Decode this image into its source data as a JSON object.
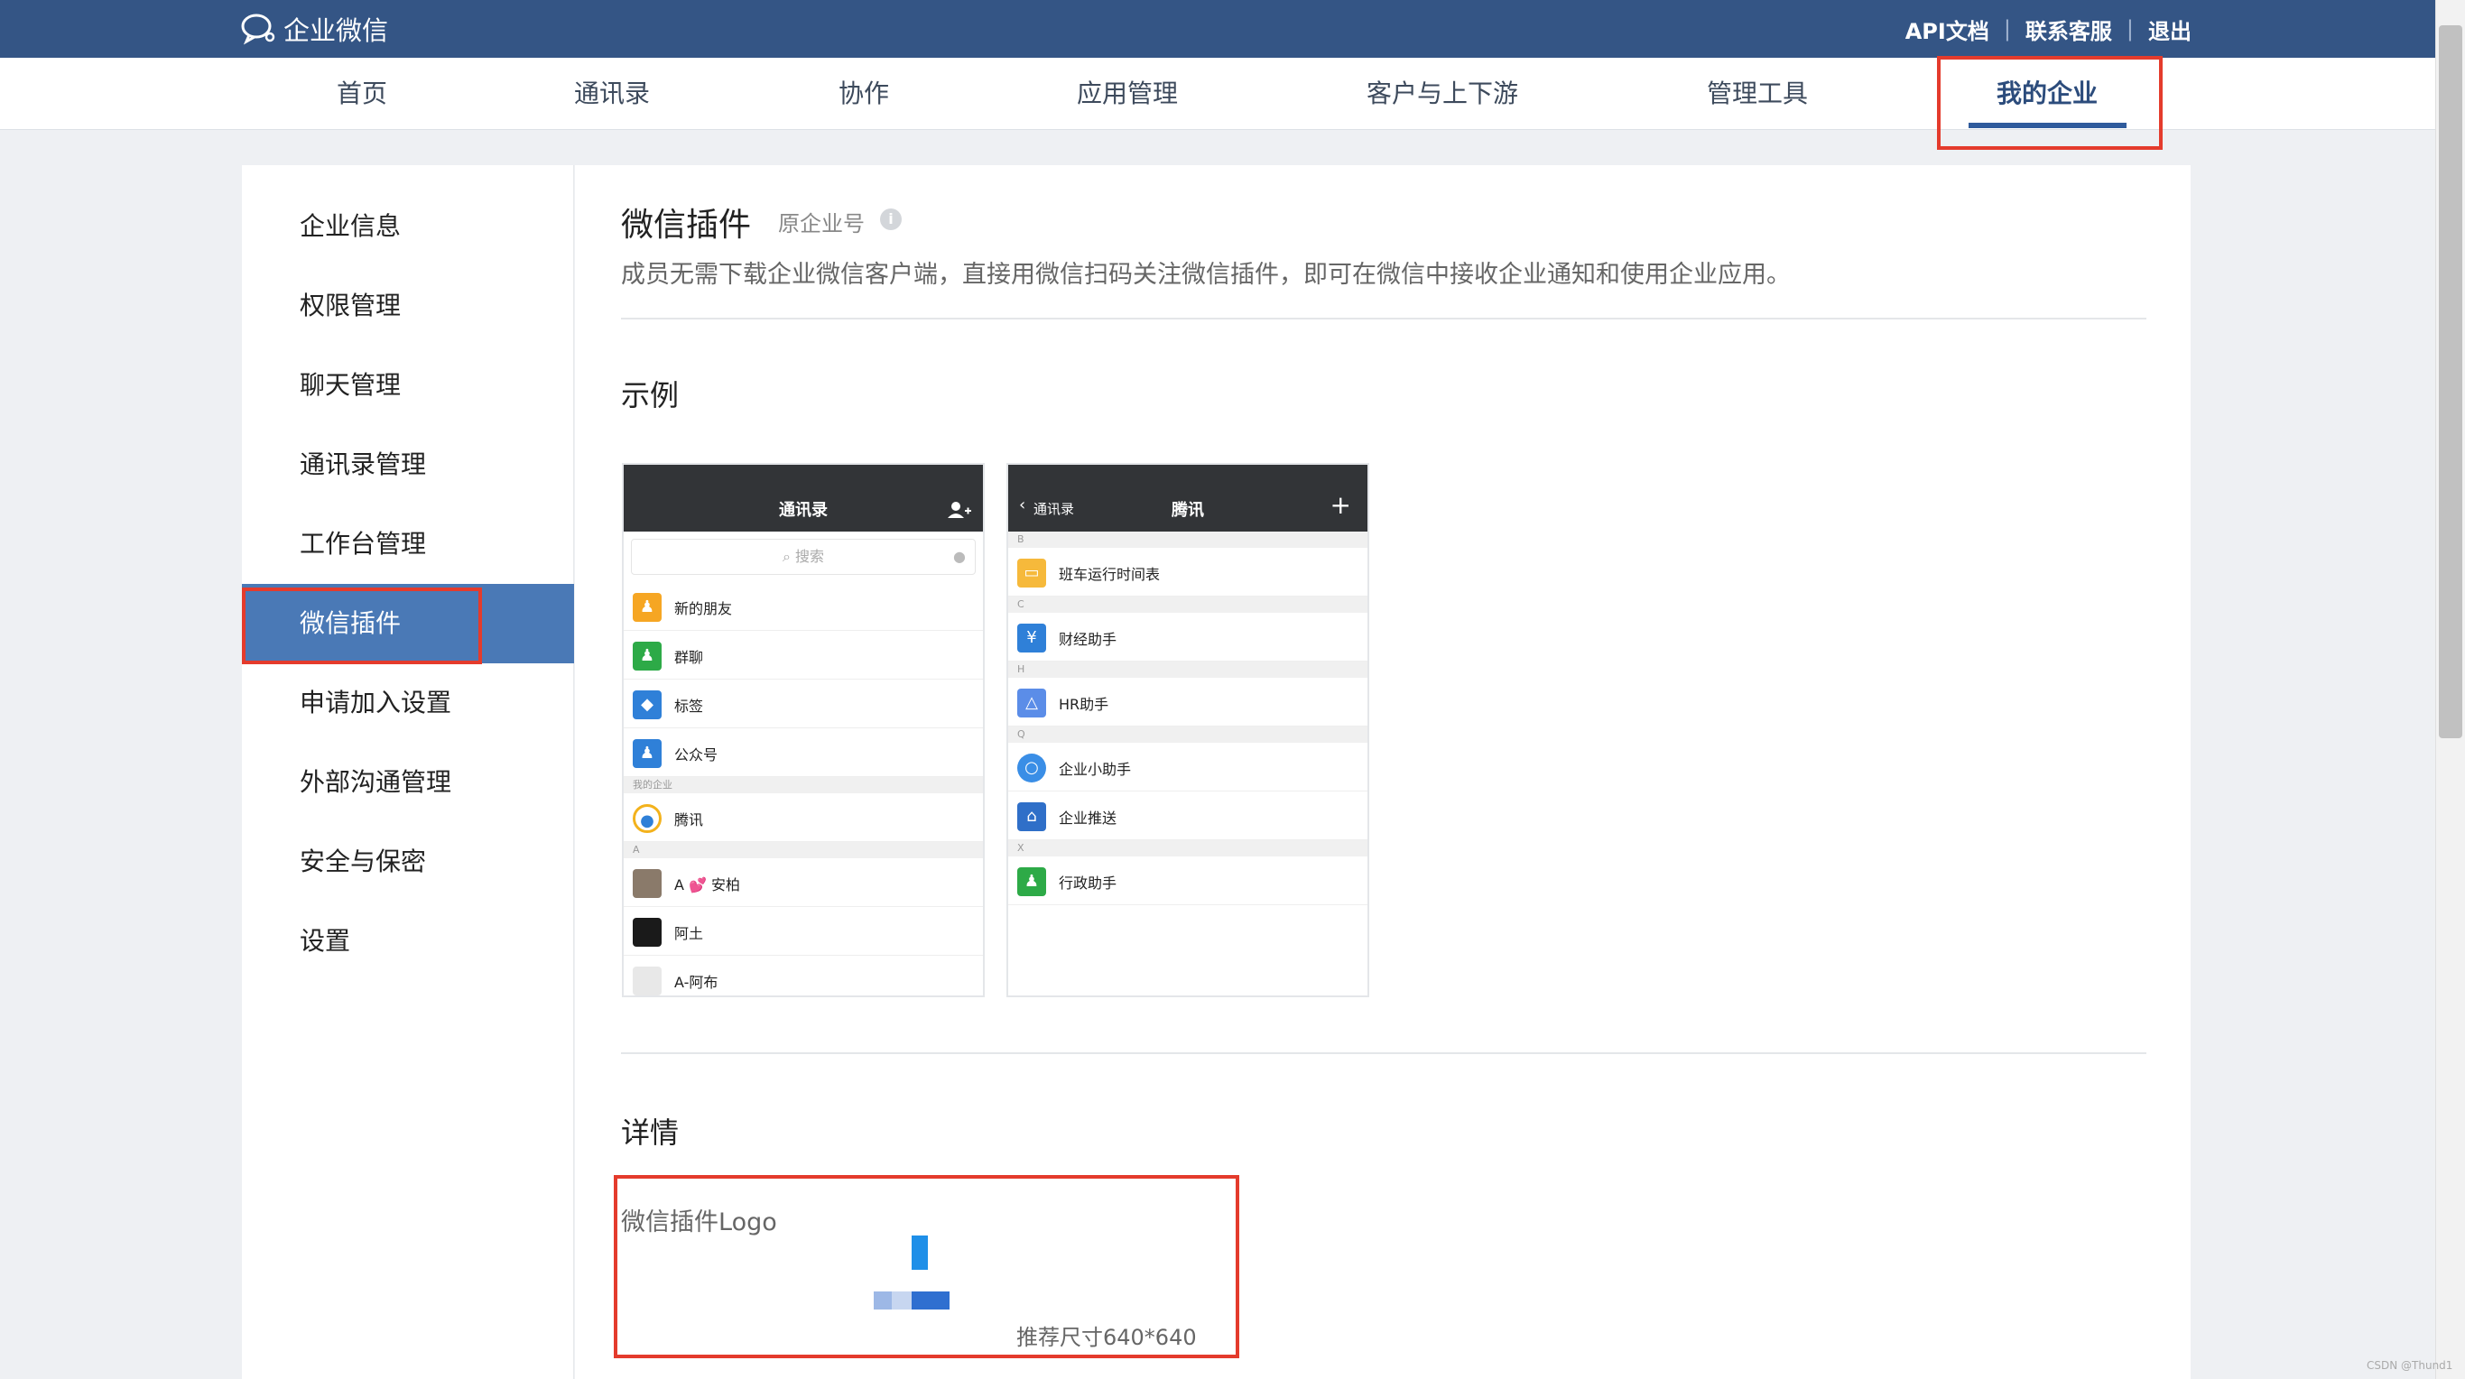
{
  "brand": {
    "name": "企业微信"
  },
  "topLinks": {
    "api": "API文档",
    "support": "联系客服",
    "logout": "退出"
  },
  "nav": {
    "home": "首页",
    "contacts": "通讯录",
    "collab": "协作",
    "apps": "应用管理",
    "customers": "客户与上下游",
    "tools": "管理工具",
    "myCompany": "我的企业"
  },
  "sidebar": {
    "items": [
      "企业信息",
      "权限管理",
      "聊天管理",
      "通讯录管理",
      "工作台管理",
      "微信插件",
      "申请加入设置",
      "外部沟通管理",
      "安全与保密",
      "设置"
    ],
    "active": "微信插件"
  },
  "main": {
    "title": "微信插件",
    "subtag": "原企业号",
    "description": "成员无需下载企业微信客户端，直接用微信扫码关注微信插件，即可在微信中接收企业通知和使用企业应用。",
    "exampleTitle": "示例",
    "detailTitle": "详情",
    "logoLabel": "微信插件Logo",
    "recommendedSize": "推荐尺寸640*640"
  },
  "phoneLeft": {
    "title": "通讯录",
    "search": "搜索",
    "items": [
      "新的朋友",
      "群聊",
      "标签",
      "公众号"
    ],
    "sectionMyCompany": "我的企业",
    "company": "腾讯",
    "sectionA": "A",
    "people": [
      "A 💕 安柏",
      "阿土",
      "A-阿布"
    ]
  },
  "phoneRight": {
    "back": "通讯录",
    "title": "腾讯",
    "plus": "+",
    "sections": [
      "B",
      "C",
      "H",
      "Q",
      "X"
    ],
    "items": [
      "班车运行时间表",
      "财经助手",
      "HR助手",
      "企业小助手",
      "企业推送",
      "行政助手"
    ]
  },
  "watermark": "CSDN @Thund1",
  "colors": {
    "topbar": "#345585",
    "accent": "#4a79b6",
    "highlight": "#e43b2c"
  }
}
